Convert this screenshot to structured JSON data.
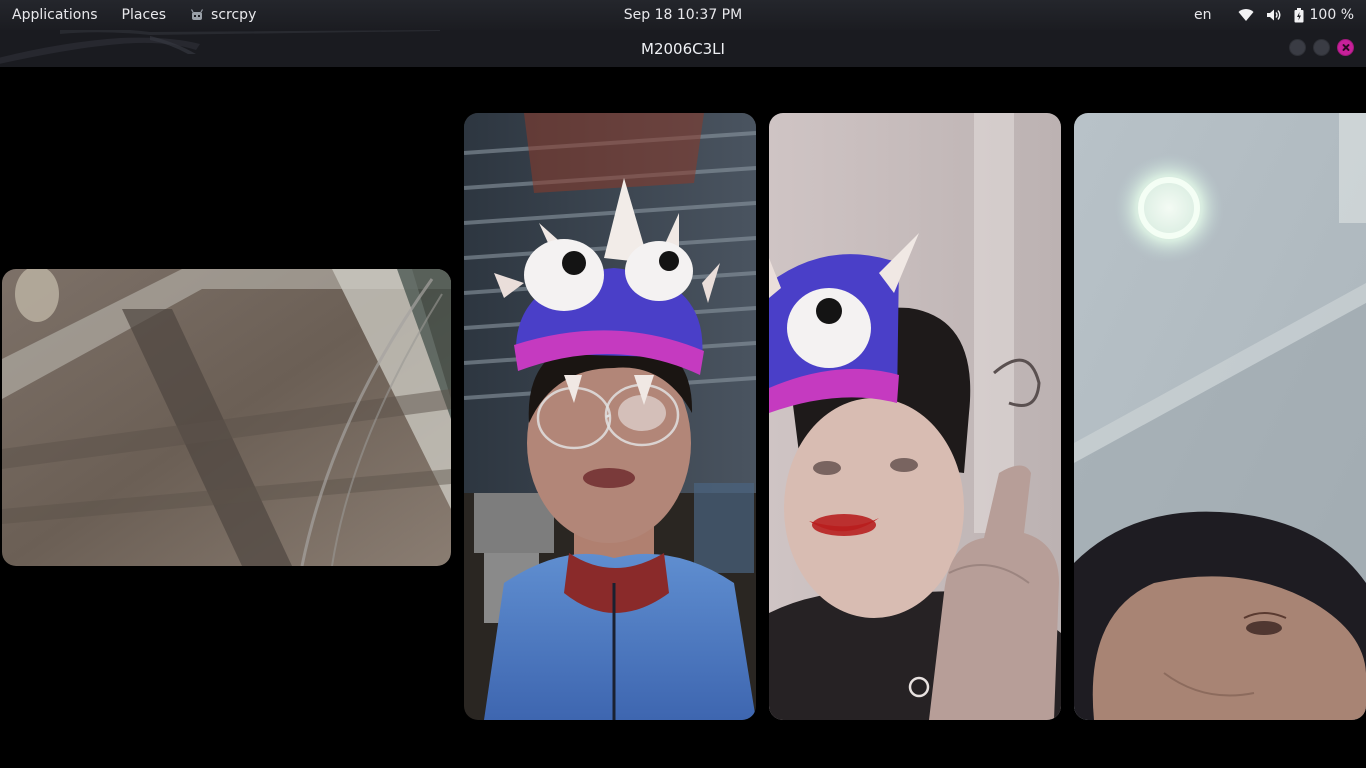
{
  "top_panel": {
    "applications_label": "Applications",
    "places_label": "Places",
    "app_name": "scrcpy",
    "clock": "Sep 18  10:37 PM",
    "keyboard_layout": "en",
    "battery_percent": "100 %",
    "icons": [
      "scrcpy-app-icon",
      "wifi-icon",
      "volume-icon",
      "battery-icon"
    ]
  },
  "window": {
    "title": "M2006C3LI",
    "buttons": [
      "minimize-button",
      "maximize-button",
      "close-button"
    ],
    "close_color": "#c8209a"
  },
  "video_tiles": [
    {
      "name": "video-tile-ceiling-wide"
    },
    {
      "name": "video-tile-person-glasses-hat"
    },
    {
      "name": "video-tile-person-hat-thumbsup"
    },
    {
      "name": "video-tile-person-ceiling-light"
    }
  ]
}
